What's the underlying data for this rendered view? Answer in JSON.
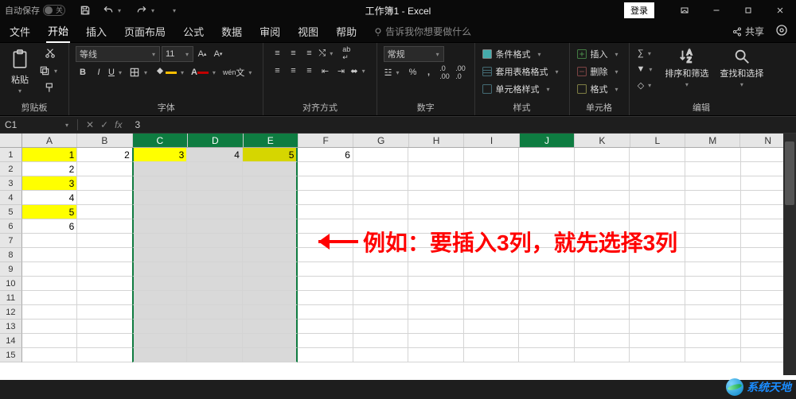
{
  "titlebar": {
    "autosave_label": "自动保存",
    "title": "工作簿1 - Excel",
    "login": "登录"
  },
  "tabs": {
    "items": [
      "文件",
      "开始",
      "插入",
      "页面布局",
      "公式",
      "数据",
      "审阅",
      "视图",
      "帮助"
    ],
    "tell_me": "告诉我你想要做什么",
    "share": "共享"
  },
  "ribbon": {
    "clipboard": {
      "paste": "粘贴",
      "label": "剪贴板"
    },
    "font": {
      "name": "等线",
      "size": "11",
      "label": "字体"
    },
    "align": {
      "label": "对齐方式"
    },
    "number": {
      "format": "常规",
      "label": "数字"
    },
    "styles": {
      "cond": "条件格式",
      "table": "套用表格格式",
      "cell": "单元格样式",
      "label": "样式"
    },
    "cells": {
      "insert": "插入",
      "delete": "删除",
      "format": "格式",
      "label": "单元格"
    },
    "editing": {
      "sort": "排序和筛选",
      "find": "查找和选择",
      "label": "编辑"
    }
  },
  "formula": {
    "namebox": "C1",
    "fx": "fx",
    "value": "3"
  },
  "sheet": {
    "cols": [
      "A",
      "B",
      "C",
      "D",
      "E",
      "F",
      "G",
      "H",
      "I",
      "J",
      "K",
      "L",
      "M",
      "N"
    ],
    "selected_cols": [
      "C",
      "D",
      "E"
    ],
    "active_col": "J",
    "rows": [
      1,
      2,
      3,
      4,
      5,
      6,
      7,
      8,
      9,
      10,
      11,
      12,
      13,
      14,
      15
    ],
    "data": {
      "r1": {
        "A": "1",
        "B": "2",
        "C": "3",
        "D": "4",
        "E": "5",
        "F": "6"
      },
      "r2": {
        "A": "2"
      },
      "r3": {
        "A": "3"
      },
      "r4": {
        "A": "4"
      },
      "r5": {
        "A": "5"
      },
      "r6": {
        "A": "6"
      }
    },
    "yellow": [
      "A1",
      "A3",
      "A5",
      "C1"
    ],
    "darkyellow": [
      "E1"
    ]
  },
  "annotation": "例如：要插入3列，就先选择3列",
  "watermark": "系统天地"
}
